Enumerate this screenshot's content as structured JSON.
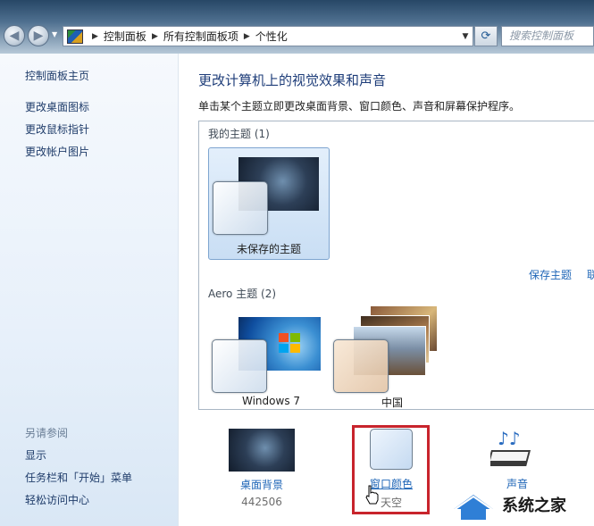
{
  "breadcrumbs": [
    "控制面板",
    "所有控制面板项",
    "个性化"
  ],
  "search": {
    "placeholder": "搜索控制面板"
  },
  "left_pane": {
    "home": "控制面板主页",
    "links": [
      "更改桌面图标",
      "更改鼠标指针",
      "更改帐户图片"
    ],
    "see_also_title": "另请参阅",
    "see_also": [
      "显示",
      "任务栏和「开始」菜单",
      "轻松访问中心"
    ]
  },
  "main": {
    "title": "更改计算机上的视觉效果和声音",
    "description": "单击某个主题立即更改桌面背景、窗口颜色、声音和屏幕保护程序。",
    "my_themes_label": "我的主题 (1)",
    "unsaved_theme": "未保存的主题",
    "save_theme": "保存主题",
    "more_link": "联",
    "aero_label": "Aero 主题 (2)",
    "aero_themes": [
      "Windows 7",
      "中国"
    ]
  },
  "bottom": {
    "background_label": "桌面背景",
    "background_value": "442506",
    "window_color_label": "窗口颜色",
    "window_color_value": "天空",
    "sound_label": "声音"
  },
  "watermark_text": "系统之家",
  "colors": {
    "link": "#1f66b7",
    "title": "#1e3d79",
    "highlight": "#c8242c"
  }
}
